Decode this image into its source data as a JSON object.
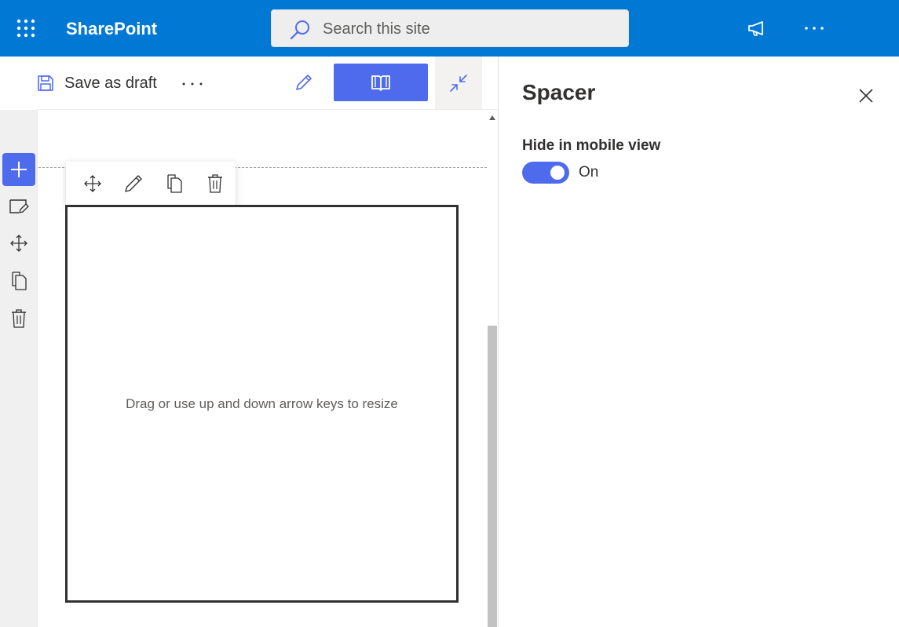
{
  "suite_bar": {
    "app_name": "SharePoint",
    "search_placeholder": "Search this site",
    "bg_color": "#0078d4"
  },
  "command_bar": {
    "save_label": "Save as draft",
    "more_label": "···"
  },
  "web_part_toolbar": {
    "tools": [
      "move-icon",
      "edit-icon",
      "duplicate-icon",
      "delete-icon"
    ]
  },
  "left_rail": {
    "tools": [
      "add-icon",
      "edit-section-icon",
      "move-icon",
      "duplicate-icon",
      "delete-icon"
    ]
  },
  "spacer": {
    "hint": "Drag or use up and down arrow keys to resize"
  },
  "property_pane": {
    "title": "Spacer",
    "field_label": "Hide in mobile view",
    "toggle_state": "On",
    "accent": "#4f6bed"
  }
}
